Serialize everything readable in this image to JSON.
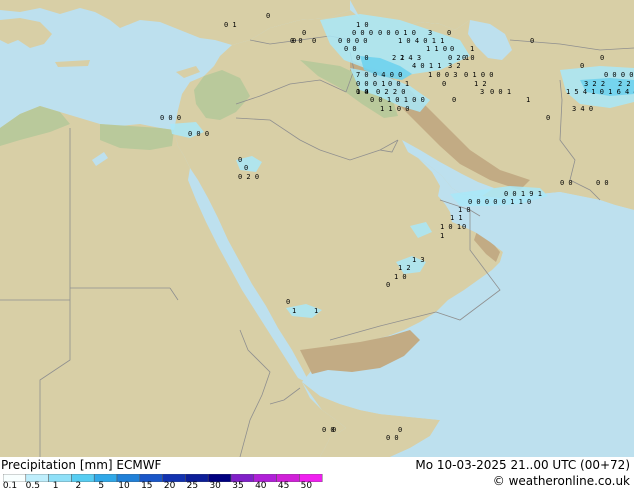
{
  "map": {
    "colors": {
      "sea": "#bde0ee",
      "land": "#d8cfa6",
      "desert": "#e4d6ae",
      "green": "#b9c99b",
      "mountain": "#c2ab84",
      "border": "#8f8f8f",
      "precip_light": "#a9e8f8",
      "precip": "#6fd2ee"
    },
    "point_values": [
      "0 1",
      "0",
      "1 0",
      "0 0 0",
      "0 0 0 1 0",
      "3",
      "0",
      "0 0",
      "0",
      "0 0 0 0",
      "1 0 4 0 1 1",
      "0",
      "0",
      "0",
      "0 0",
      "1 1 0",
      "0",
      "0 0",
      "2 1",
      "2 4 3",
      "0 2 1",
      "0 0",
      "1",
      "4 0 1 1",
      "3 2",
      "7 0 0 4 0 0",
      "1 0 0 3",
      "0 1 0 0",
      "0 0 0 1",
      "1 2",
      "0",
      "1 0",
      "0 0 1",
      "3",
      "3 2 2",
      "0 4",
      "0 2 2 0",
      "0",
      "0 0 1",
      "0",
      "1",
      "1 5 4 1 0 1 6 4 4 8 2",
      "2 2",
      "0 0 1 0 1 0 0",
      "1 1 0 0",
      "0 0 0 0 1",
      "3 4 0",
      "0",
      "0",
      "0 0 0",
      "0 0 0",
      "0",
      "0",
      "0 2 0",
      "0 0",
      "0 0 1 9 1",
      "0 0",
      "0 0 0 0 0 1 1 0",
      "1 0",
      "1 1",
      "1 0 1",
      "1",
      "0",
      "1 2",
      "1 3",
      "1 0",
      "0",
      "0",
      "1",
      "1",
      "0 0",
      "0",
      "0 0",
      "0"
    ]
  },
  "footer": {
    "title": "Precipitation [mm] ECMWF",
    "valid": "Mo 10-03-2025 21..00 UTC (00+72)",
    "credit": "© weatheronline.co.uk",
    "scale": [
      {
        "label": "0.1",
        "color": "#f8ffff"
      },
      {
        "label": "0.5",
        "color": "#bfeefc"
      },
      {
        "label": "1",
        "color": "#8fe0f8"
      },
      {
        "label": "2",
        "color": "#57cdf2"
      },
      {
        "label": "5",
        "color": "#30a8e8"
      },
      {
        "label": "10",
        "color": "#2080d8"
      },
      {
        "label": "15",
        "color": "#1a56c8"
      },
      {
        "label": "20",
        "color": "#1232b0"
      },
      {
        "label": "25",
        "color": "#0c1e98"
      },
      {
        "label": "30",
        "color": "#000080"
      },
      {
        "label": "35",
        "color": "#8020c8"
      },
      {
        "label": "40",
        "color": "#b020d8"
      },
      {
        "label": "45",
        "color": "#d020d8"
      },
      {
        "label": "50",
        "color": "#f020f0"
      }
    ]
  }
}
